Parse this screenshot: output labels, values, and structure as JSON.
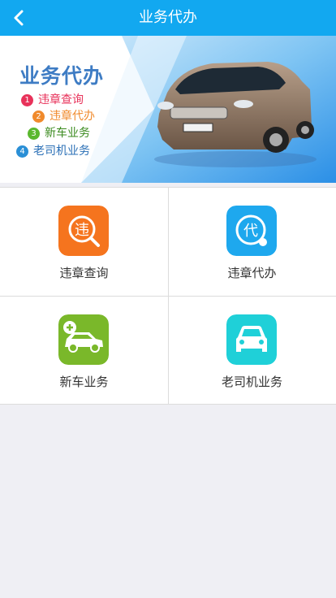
{
  "header": {
    "title": "业务代办",
    "back_icon": "chevron-left-icon"
  },
  "banner": {
    "title": "业务代办",
    "items": [
      {
        "num": "1",
        "label": "违章查询",
        "color": "#e8325a"
      },
      {
        "num": "2",
        "label": "违章代办",
        "color": "#f08a2c"
      },
      {
        "num": "3",
        "label": "新车业务",
        "color": "#5ab82e"
      },
      {
        "num": "4",
        "label": "老司机业务",
        "color": "#2a8fd6"
      }
    ]
  },
  "services": [
    {
      "label": "违章查询",
      "icon": "violation-query-icon",
      "color": "#f5741e"
    },
    {
      "label": "违章代办",
      "icon": "agency-icon",
      "color": "#1ea8ee"
    },
    {
      "label": "新车业务",
      "icon": "new-car-icon",
      "color": "#7ab82a"
    },
    {
      "label": "老司机业务",
      "icon": "car-front-icon",
      "color": "#1fd0d8"
    }
  ]
}
